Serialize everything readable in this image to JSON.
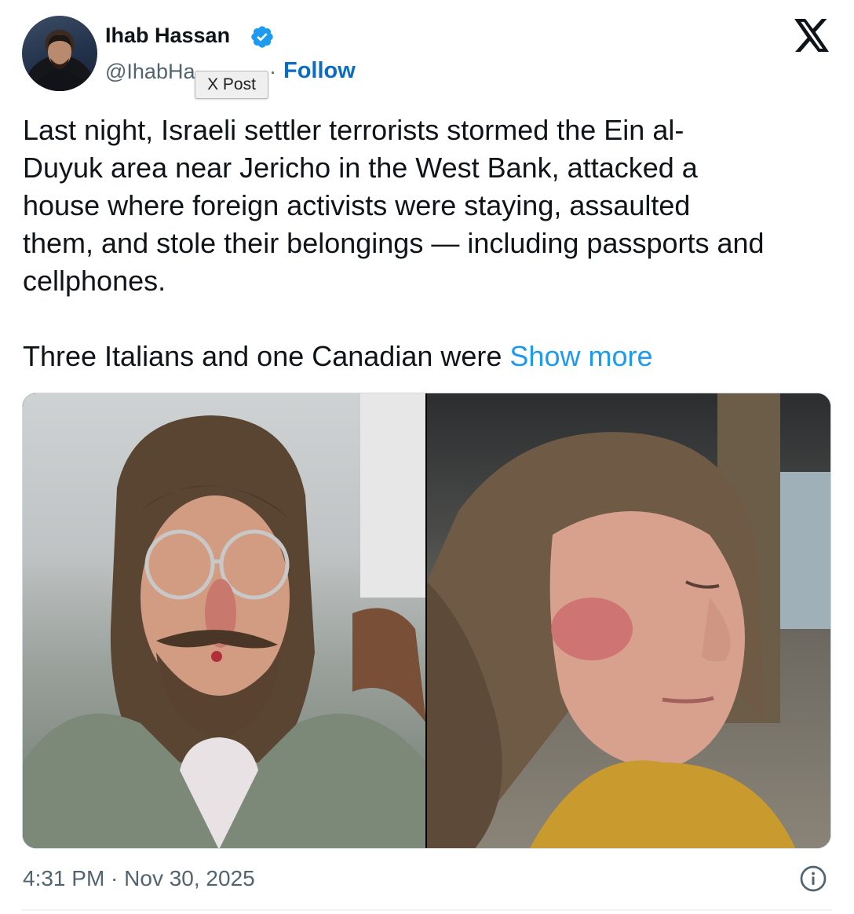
{
  "author": {
    "name": "Ihab Hassan",
    "handle": "@IhabHa",
    "separator": "·",
    "follow_label": "Follow"
  },
  "tooltip": "X Post",
  "logo_icon": "x-logo-icon",
  "post": {
    "paragraph1": "Last night, Israeli settler terrorists stormed the Ein al-\nDuyuk area near Jericho in the West Bank, attacked a\nhouse where foreign activists were staying, assaulted\nthem, and stole their belongings — including passports and\ncellphones.",
    "paragraph2": "Three Italians and one Canadian were ",
    "show_more": "Show more"
  },
  "media": {
    "count": 2,
    "items": [
      "photo-young-man-injured-face",
      "photo-woman-bruised-cheek"
    ]
  },
  "footer": {
    "timestamp": "4:31 PM · Nov 30, 2025",
    "info_icon": "info-icon"
  },
  "colors": {
    "accent_link": "#1d9bf0",
    "follow": "#0b6cc4",
    "verified": "#1d9bf0",
    "secondary_text": "#536471"
  }
}
